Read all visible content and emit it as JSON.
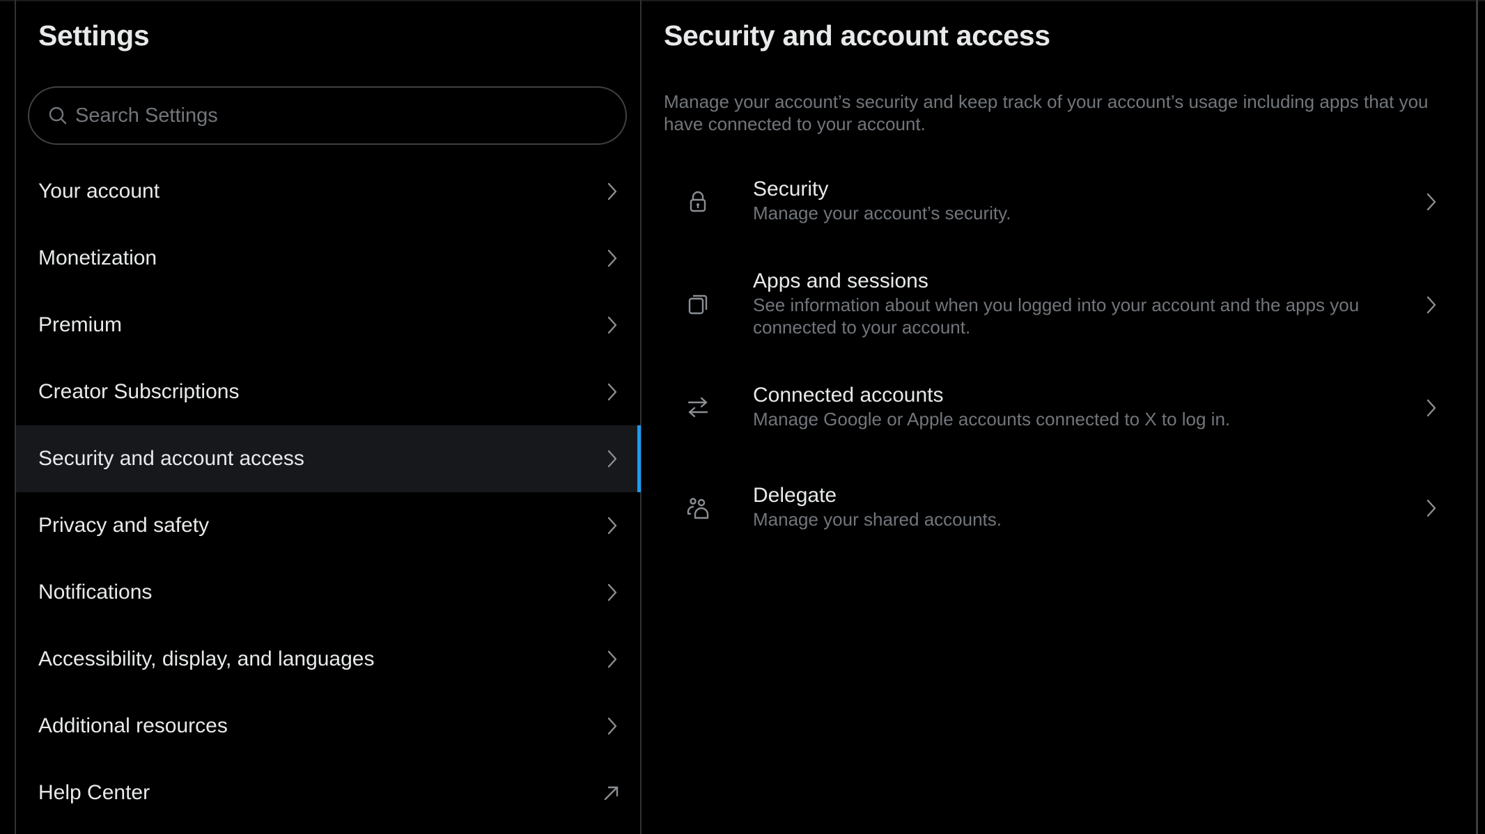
{
  "sidebar": {
    "title": "Settings",
    "search": {
      "placeholder": "Search Settings",
      "value": "",
      "icon": "search-icon"
    },
    "items": [
      {
        "label": "Your account",
        "icon": "chevron-right-icon",
        "active": false
      },
      {
        "label": "Monetization",
        "icon": "chevron-right-icon",
        "active": false
      },
      {
        "label": "Premium",
        "icon": "chevron-right-icon",
        "active": false
      },
      {
        "label": "Creator Subscriptions",
        "icon": "chevron-right-icon",
        "active": false
      },
      {
        "label": "Security and account access",
        "icon": "chevron-right-icon",
        "active": true
      },
      {
        "label": "Privacy and safety",
        "icon": "chevron-right-icon",
        "active": false
      },
      {
        "label": "Notifications",
        "icon": "chevron-right-icon",
        "active": false
      },
      {
        "label": "Accessibility, display, and languages",
        "icon": "chevron-right-icon",
        "active": false
      },
      {
        "label": "Additional resources",
        "icon": "chevron-right-icon",
        "active": false
      },
      {
        "label": "Help Center",
        "icon": "external-link-arrow-icon",
        "active": false
      }
    ]
  },
  "main": {
    "title": "Security and account access",
    "description": "Manage your account’s security and keep track of your account’s usage including apps that you have connected to your account.",
    "options": [
      {
        "title": "Security",
        "subtitle": "Manage your account’s security.",
        "icon": "lock-icon"
      },
      {
        "title": "Apps and sessions",
        "subtitle": "See information about when you logged into your account and the apps you connected to your account.",
        "icon": "apps-stack-icon"
      },
      {
        "title": "Connected accounts",
        "subtitle": "Manage Google or Apple accounts connected to X to log in.",
        "icon": "swap-arrows-icon"
      },
      {
        "title": "Delegate",
        "subtitle": "Manage your shared accounts.",
        "icon": "people-icon"
      }
    ]
  },
  "colors": {
    "background": "#000000",
    "active_row": "#16181c",
    "accent": "#1d9bf0",
    "primary_text": "#e7e9ea",
    "secondary_text": "#71767b",
    "border": "#2f3336"
  }
}
